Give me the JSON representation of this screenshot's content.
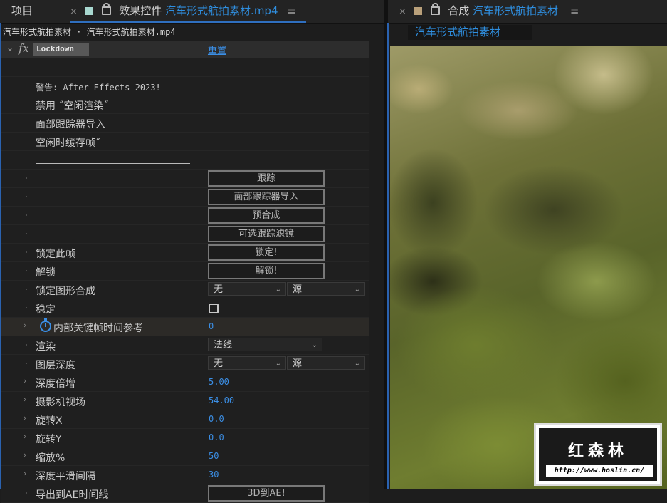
{
  "project_tab": {
    "label": "项目"
  },
  "effects_tab": {
    "close": "×",
    "label": "效果控件",
    "clip_name": "汽车形式航拍素材.mp4",
    "menu": "≡"
  },
  "comp_tab": {
    "close": "×",
    "label": "合成",
    "comp_name": "汽车形式航拍素材",
    "menu": "≡"
  },
  "breadcrumb": "汽车形式航拍素材 · 汽车形式航拍素材.mp4",
  "effect": {
    "fx_symbol": "fx",
    "name": "Lockdown",
    "reset": "重置"
  },
  "info_lines": [
    "警告: After Effects 2023!",
    "禁用 ˝空闲渲染˝",
    "面部跟踪器导入",
    "空闲时缓存帧˝"
  ],
  "buttons": {
    "track": "跟踪",
    "face_import": "面部跟踪器导入",
    "precomp": "预合成",
    "optional_filter": "可选跟踪滤镜",
    "lock": "锁定!",
    "unlock": "解锁!",
    "export_3d": "3D到AE!"
  },
  "params": {
    "lock_frame": "锁定此帧",
    "unlock": "解锁",
    "lock_shape": {
      "label": "锁定图形合成",
      "sel1": "无",
      "sel2": "源"
    },
    "stabilize": "稳定",
    "internal_key": {
      "label": "内部关键帧时间参考",
      "value": "0"
    },
    "render": {
      "label": "渲染",
      "value": "法线"
    },
    "layer_depth": {
      "label": "图层深度",
      "sel1": "无",
      "sel2": "源"
    },
    "depth_multiplier": {
      "label": "深度倍增",
      "value": "5.00"
    },
    "camera_fov": {
      "label": "摄影机视场",
      "value": "54.00"
    },
    "rotate_x": {
      "label": "旋转X",
      "value": "0.0"
    },
    "rotate_y": {
      "label": "旋转Y",
      "value": "0.0"
    },
    "scale": {
      "label": "缩放%",
      "value": "50"
    },
    "depth_smoothing": {
      "label": "深度平滑间隔",
      "value": "30"
    },
    "export_timeline": "导出到AE时间线"
  },
  "watermark": {
    "brand": "红森林",
    "url": "http://www.hoslin.cn/"
  },
  "colors": {
    "accent": "#2f8fe0",
    "panel": "#1f1f1f",
    "label_swatch": "#a8d8d0",
    "comp_swatch": "#b9a07a"
  }
}
